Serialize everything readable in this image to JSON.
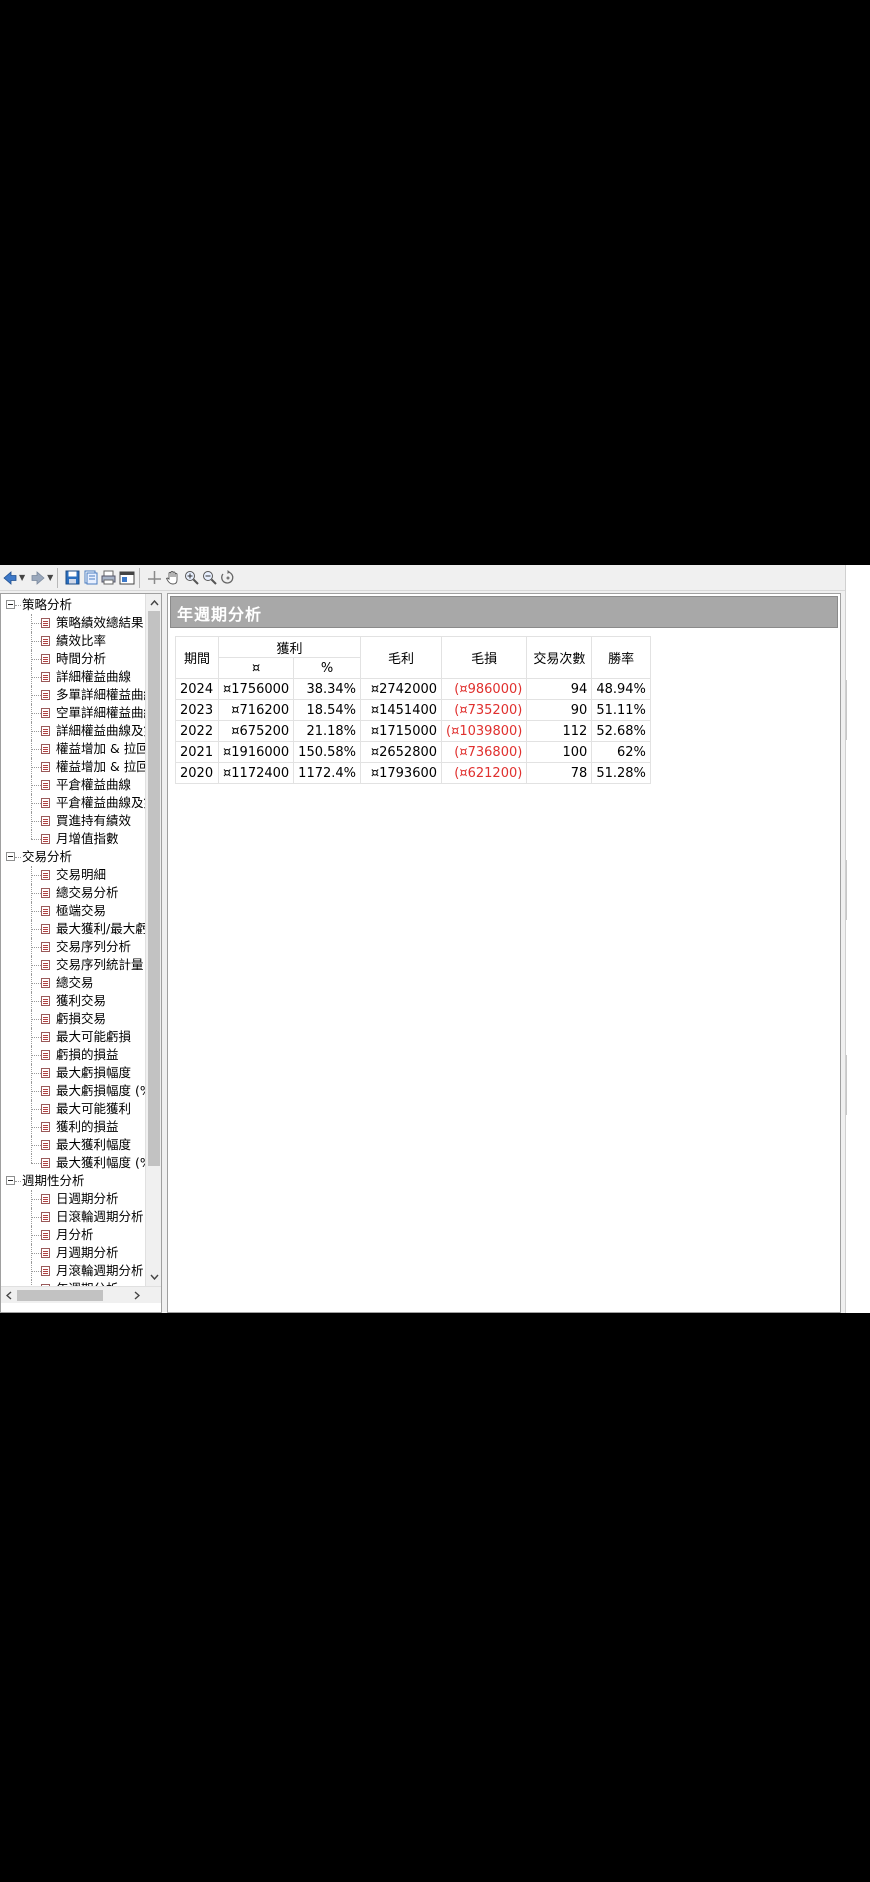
{
  "toolbar": {
    "buttons": [
      "back-arrow-icon",
      "forward-arrow-icon",
      "save-icon",
      "copy-icon",
      "print-icon",
      "window-icon",
      "cross-cursor-icon",
      "hand-icon",
      "zoom-in-icon",
      "zoom-out-icon",
      "reset-zoom-icon"
    ]
  },
  "tree": {
    "categories": [
      {
        "label": "策略分析",
        "items": [
          "策略績效總結果",
          "績效比率",
          "時間分析",
          "詳細權益曲線",
          "多單詳細權益曲線",
          "空單詳細權益曲線",
          "詳細權益曲線及雙",
          "權益增加 & 拉回",
          "權益增加 & 拉回(",
          "平倉權益曲線",
          "平倉權益曲線及雙",
          "買進持有績效",
          "月增值指數"
        ]
      },
      {
        "label": "交易分析",
        "items": [
          "交易明細",
          "總交易分析",
          "極端交易",
          "最大獲利/最大虧",
          "交易序列分析",
          "交易序列統計量",
          "總交易",
          "獲利交易",
          "虧損交易",
          "最大可能虧損",
          "虧損的損益",
          "最大虧損幅度",
          "最大虧損幅度 (%",
          "最大可能獲利",
          "獲利的損益",
          "最大獲利幅度",
          "最大獲利幅度 (%"
        ]
      },
      {
        "label": "週期性分析",
        "items": [
          "日週期分析",
          "日滾輪週期分析",
          "月分析",
          "月週期分析",
          "月滾輪週期分析",
          "年週期分析"
        ]
      }
    ]
  },
  "report": {
    "title": "年週期分析",
    "headers": {
      "period": "期間",
      "profit": "獲利",
      "profit_currency": "¤",
      "profit_percent": "%",
      "gross_profit": "毛利",
      "gross_loss": "毛損",
      "trades": "交易次數",
      "win_rate": "勝率"
    },
    "rows": [
      {
        "period": "2024",
        "profit": "¤1756000",
        "percent": "38.34%",
        "gross_profit": "¤2742000",
        "gross_loss": "(¤986000)",
        "trades": "94",
        "win_rate": "48.94%"
      },
      {
        "period": "2023",
        "profit": "¤716200",
        "percent": "18.54%",
        "gross_profit": "¤1451400",
        "gross_loss": "(¤735200)",
        "trades": "90",
        "win_rate": "51.11%"
      },
      {
        "period": "2022",
        "profit": "¤675200",
        "percent": "21.18%",
        "gross_profit": "¤1715000",
        "gross_loss": "(¤1039800)",
        "trades": "112",
        "win_rate": "52.68%"
      },
      {
        "period": "2021",
        "profit": "¤1916000",
        "percent": "150.58%",
        "gross_profit": "¤2652800",
        "gross_loss": "(¤736800)",
        "trades": "100",
        "win_rate": "62%"
      },
      {
        "period": "2020",
        "profit": "¤1172400",
        "percent": "1172.4%",
        "gross_profit": "¤1793600",
        "gross_loss": "(¤621200)",
        "trades": "78",
        "win_rate": "51.28%"
      }
    ]
  },
  "colors": {
    "loss_text": "#e0302e",
    "header_bg": "#a8a8a8"
  }
}
